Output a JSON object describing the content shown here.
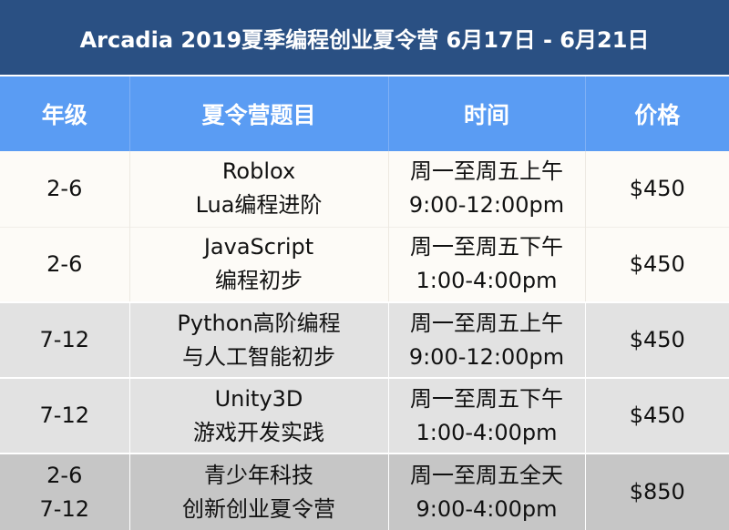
{
  "title": "Arcadia 2019夏季编程创业夏令营 6月17日 - 6月21日",
  "headers": {
    "grade": "年级",
    "topic": "夏令营题目",
    "time": "时间",
    "price": "价格"
  },
  "rows": [
    {
      "grade": [
        "2-6"
      ],
      "topic": [
        "Roblox",
        "Lua编程进阶"
      ],
      "time": [
        "周一至周五上午",
        "9:00-12:00pm"
      ],
      "price": "$450"
    },
    {
      "grade": [
        "2-6"
      ],
      "topic": [
        "JavaScript",
        "编程初步"
      ],
      "time": [
        "周一至周五下午",
        "1:00-4:00pm"
      ],
      "price": "$450"
    },
    {
      "grade": [
        "7-12"
      ],
      "topic": [
        "Python高阶编程",
        "与人工智能初步"
      ],
      "time": [
        "周一至周五上午",
        "9:00-12:00pm"
      ],
      "price": "$450"
    },
    {
      "grade": [
        "7-12"
      ],
      "topic": [
        "Unity3D",
        "游戏开发实践"
      ],
      "time": [
        "周一至周五下午",
        "1:00-4:00pm"
      ],
      "price": "$450"
    },
    {
      "grade": [
        "2-6",
        "7-12"
      ],
      "topic": [
        "青少年科技",
        "创新创业夏令营"
      ],
      "time": [
        "周一至周五全天",
        "9:00-4:00pm"
      ],
      "price": "$850"
    }
  ],
  "colors": {
    "title_bg": "#2a5083",
    "header_bg": "#5a9cf3",
    "row_light": "#fdfbf7",
    "row_mid": "#e2e2e2",
    "row_dark": "#c6c6c6"
  }
}
